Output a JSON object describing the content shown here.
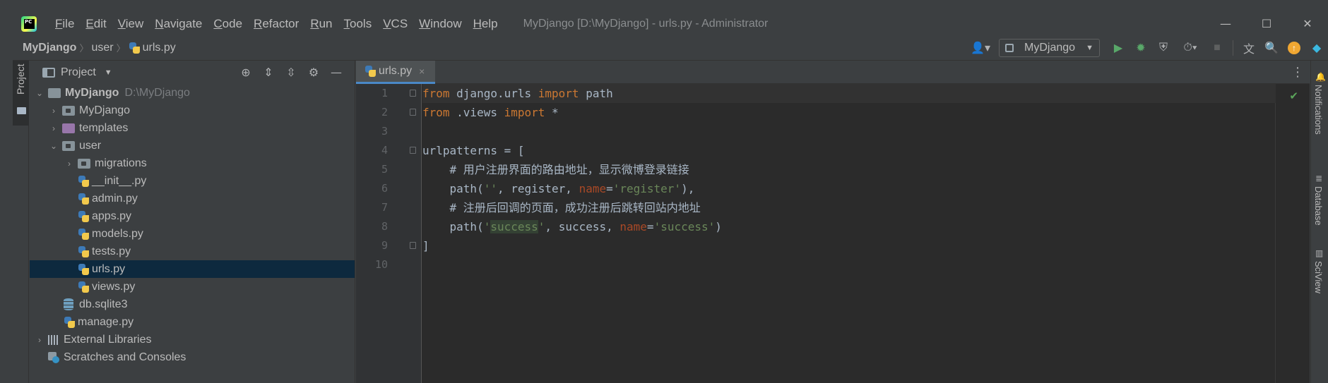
{
  "menu": [
    "File",
    "Edit",
    "View",
    "Navigate",
    "Code",
    "Refactor",
    "Run",
    "Tools",
    "VCS",
    "Window",
    "Help"
  ],
  "window_title": "MyDjango [D:\\MyDjango] - urls.py - Administrator",
  "window_controls": {
    "minimize": "—",
    "maximize": "☐",
    "close": "✕"
  },
  "breadcrumb": {
    "project": "MyDjango",
    "folder": "user",
    "file": "urls.py"
  },
  "run_config": {
    "label": "MyDjango"
  },
  "left_strip": {
    "project_tab": "Project"
  },
  "project_panel": {
    "title": "Project",
    "tree": [
      {
        "label": "MyDjango",
        "hint": "D:\\MyDjango"
      },
      {
        "label": "MyDjango"
      },
      {
        "label": "templates"
      },
      {
        "label": "user"
      },
      {
        "label": "migrations"
      },
      {
        "label": "__init__.py"
      },
      {
        "label": "admin.py"
      },
      {
        "label": "apps.py"
      },
      {
        "label": "models.py"
      },
      {
        "label": "tests.py"
      },
      {
        "label": "urls.py"
      },
      {
        "label": "views.py"
      },
      {
        "label": "db.sqlite3"
      },
      {
        "label": "manage.py"
      },
      {
        "label": "External Libraries"
      },
      {
        "label": "Scratches and Consoles"
      }
    ]
  },
  "editor": {
    "tab_label": "urls.py",
    "line_numbers": [
      "1",
      "2",
      "3",
      "4",
      "5",
      "6",
      "7",
      "8",
      "9",
      "10"
    ],
    "code": {
      "l1_kw1": "from",
      "l1_mod": " django.urls ",
      "l1_kw2": "import",
      "l1_name": " path",
      "l2_kw1": "from",
      "l2_mod": " .views ",
      "l2_kw2": "import",
      "l2_star": " *",
      "l4": "urlpatterns = [",
      "l5": "    # 用户注册界面的路由地址，显示微博登录链接",
      "l6_a": "    path(",
      "l6_s1": "''",
      "l6_b": ", register, ",
      "l6_kw": "name",
      "l6_eq": "=",
      "l6_s2": "'register'",
      "l6_c": "),",
      "l7": "    # 注册后回调的页面，成功注册后跳转回站内地址",
      "l8_a": "    path(",
      "l8_q1": "'",
      "l8_ref": "success",
      "l8_q2": "'",
      "l8_b": ", success, ",
      "l8_kw": "name",
      "l8_eq": "=",
      "l8_s": "'success'",
      "l8_c": ")",
      "l9": "]"
    }
  },
  "right_strip": {
    "notifications": "Notifications",
    "database": "Database",
    "sciview": "SciView"
  },
  "colors": {
    "keyword": "#cc7832",
    "string": "#6a8759",
    "comment": "#808080",
    "named_arg": "#aa4926",
    "selection": "#0d293e"
  }
}
